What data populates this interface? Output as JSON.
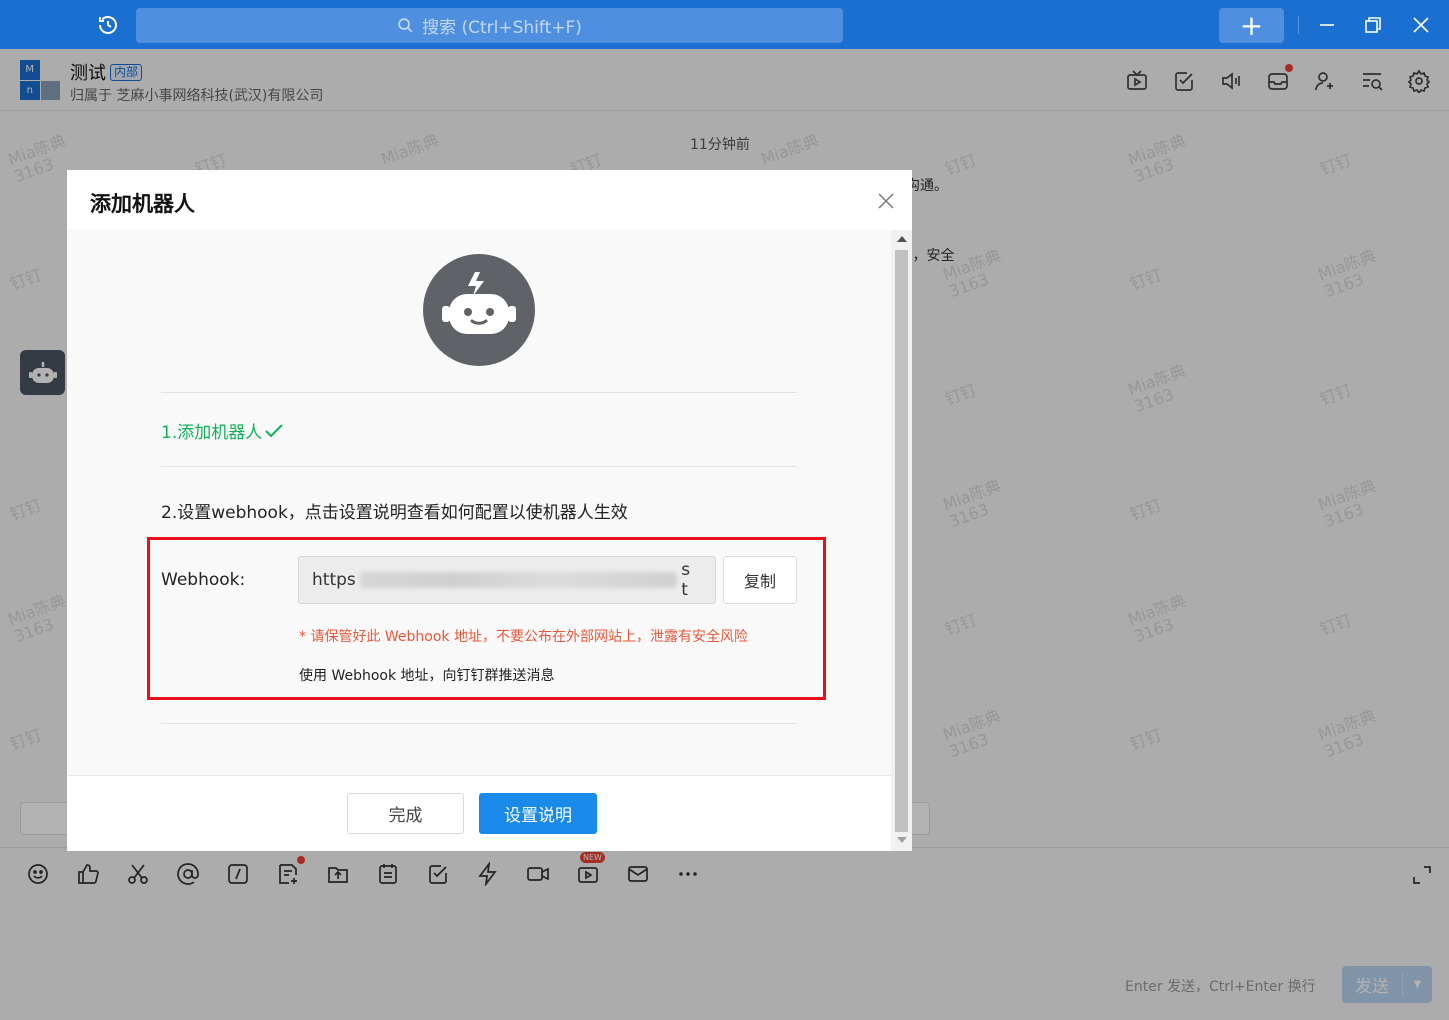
{
  "topbar": {
    "search_placeholder": "搜索 (Ctrl+Shift+F)",
    "add_symbol": "+"
  },
  "chat": {
    "group_name": "测试",
    "group_badge": "内部",
    "group_org": "归属于 芝麻小事网络科技(武汉)有限公司",
    "avatar_tiles": [
      "M",
      "",
      "n",
      ""
    ],
    "timestamp": "11分钟前",
    "msg_fragment_1": "沟通。",
    "msg_fragment_2": "\"，安全",
    "watermark_name": "Mia陈典",
    "watermark_id": "3163",
    "watermark_app": "钉钉"
  },
  "input": {
    "hint": "Enter 发送，Ctrl+Enter 换行",
    "send_label": "发送",
    "new_badge": "NEW"
  },
  "modal": {
    "title": "添加机器人",
    "step1": "1.添加机器人",
    "step2": "2.设置webhook，点击设置说明查看如何配置以使机器人生效",
    "webhook_label": "Webhook:",
    "webhook_prefix": "https",
    "webhook_suffix": "s t",
    "copy_label": "复制",
    "warning": "* 请保管好此 Webhook 地址，不要公布在外部网站上，泄露有安全风险",
    "usage": "使用 Webhook 地址，向钉钉群推送消息",
    "done_label": "完成",
    "help_label": "设置说明"
  },
  "colors": {
    "brand": "#1b6fd0",
    "success": "#13b05a",
    "warning": "#e55a3c",
    "highlight": "#e8111a",
    "primary_button": "#1a8aea"
  }
}
